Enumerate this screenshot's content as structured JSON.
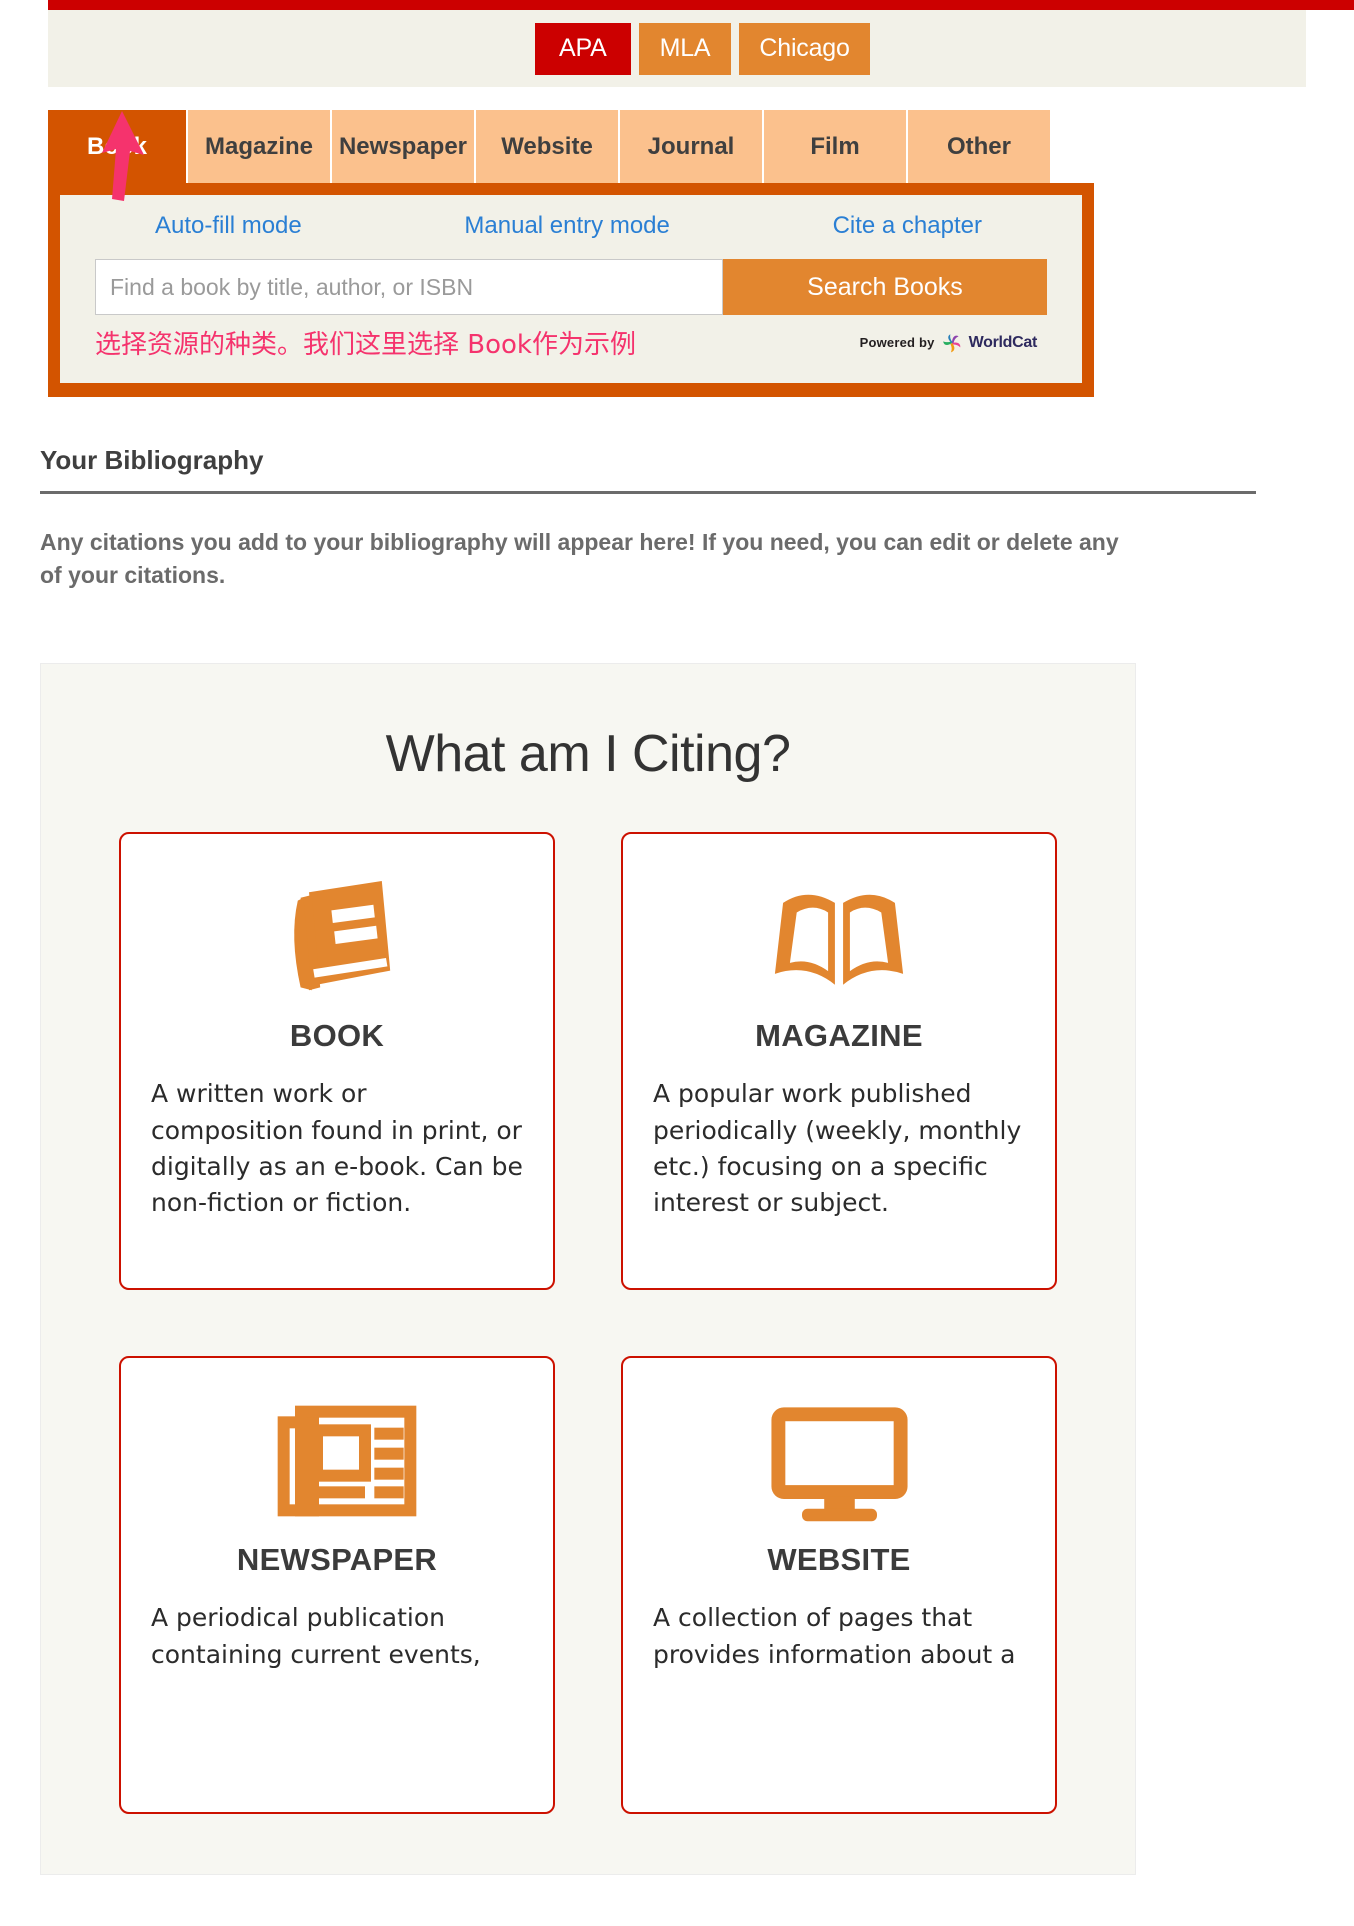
{
  "colors": {
    "red": "#cc0000",
    "orange": "#e2862f",
    "dark_orange": "#d35400",
    "light_orange": "#fbc18d",
    "link_blue": "#2a7fd4",
    "annotation_pink": "#f5336d",
    "card_border_red": "#cc1100"
  },
  "style_selector": {
    "options": [
      {
        "label": "APA",
        "active": true
      },
      {
        "label": "MLA",
        "active": false
      },
      {
        "label": "Chicago",
        "active": false
      }
    ]
  },
  "source_tabs": [
    {
      "label": "Book",
      "active": true
    },
    {
      "label": "Magazine",
      "active": false
    },
    {
      "label": "Newspaper",
      "active": false
    },
    {
      "label": "Website",
      "active": false
    },
    {
      "label": "Journal",
      "active": false
    },
    {
      "label": "Film",
      "active": false
    },
    {
      "label": "Other",
      "active": false
    }
  ],
  "search_panel": {
    "modes": [
      {
        "label": "Auto-fill mode"
      },
      {
        "label": "Manual entry mode"
      },
      {
        "label": "Cite a chapter"
      }
    ],
    "input": {
      "value": "",
      "placeholder": "Find a book by title, author, or ISBN"
    },
    "search_button": "Search Books",
    "annotation": "选择资源的种类。我们这里选择 Book作为示例",
    "powered_by": {
      "prefix": "Powered by",
      "brand": "WorldCat"
    }
  },
  "bibliography": {
    "title": "Your Bibliography",
    "empty_text": "Any citations you add to your bibliography will appear here! If you need, you can edit or delete any of your citations."
  },
  "citing": {
    "title": "What am I Citing?",
    "cards": [
      {
        "icon": "closed-book-icon",
        "label": "BOOK",
        "description": "A written work or composition found in print, or digitally as an e-book. Can be non-fiction or fiction."
      },
      {
        "icon": "open-book-icon",
        "label": "MAGAZINE",
        "description": "A popular work published periodically (weekly, monthly etc.) focusing on a specific interest or subject."
      },
      {
        "icon": "newspaper-icon",
        "label": "NEWSPAPER",
        "description": "A periodical publication containing current events,"
      },
      {
        "icon": "monitor-icon",
        "label": "WEBSITE",
        "description": "A collection of pages that provides information about a"
      }
    ]
  }
}
